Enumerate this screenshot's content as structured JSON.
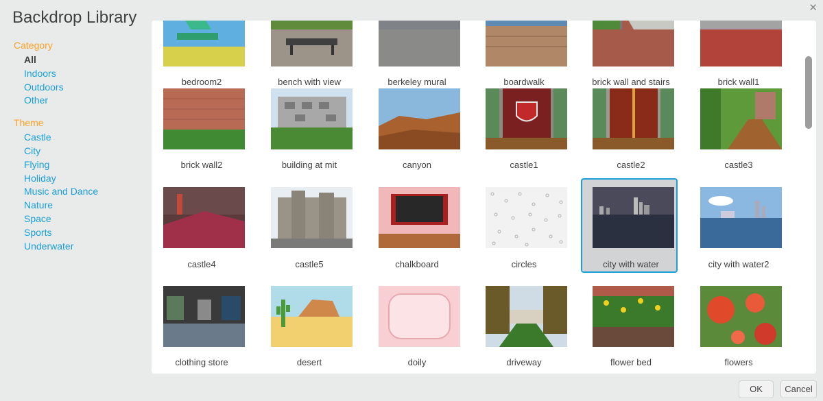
{
  "dialog": {
    "title": "Backdrop Library",
    "ok_label": "OK",
    "cancel_label": "Cancel"
  },
  "sidebar": {
    "category_heading": "Category",
    "categories": [
      "All",
      "Indoors",
      "Outdoors",
      "Other"
    ],
    "selected_category": "All",
    "theme_heading": "Theme",
    "themes": [
      "Castle",
      "City",
      "Flying",
      "Holiday",
      "Music and Dance",
      "Nature",
      "Space",
      "Sports",
      "Underwater"
    ]
  },
  "backdrops": [
    [
      "bedroom2",
      "bench with view",
      "berkeley mural",
      "boardwalk",
      "brick wall and stairs",
      "brick wall1"
    ],
    [
      "brick wall2",
      "building at mit",
      "canyon",
      "castle1",
      "castle2",
      "castle3"
    ],
    [
      "castle4",
      "castle5",
      "chalkboard",
      "circles",
      "city with water",
      "city with water2"
    ],
    [
      "clothing store",
      "desert",
      "doily",
      "driveway",
      "flower bed",
      "flowers"
    ]
  ],
  "selected_backdrop": "city with water"
}
